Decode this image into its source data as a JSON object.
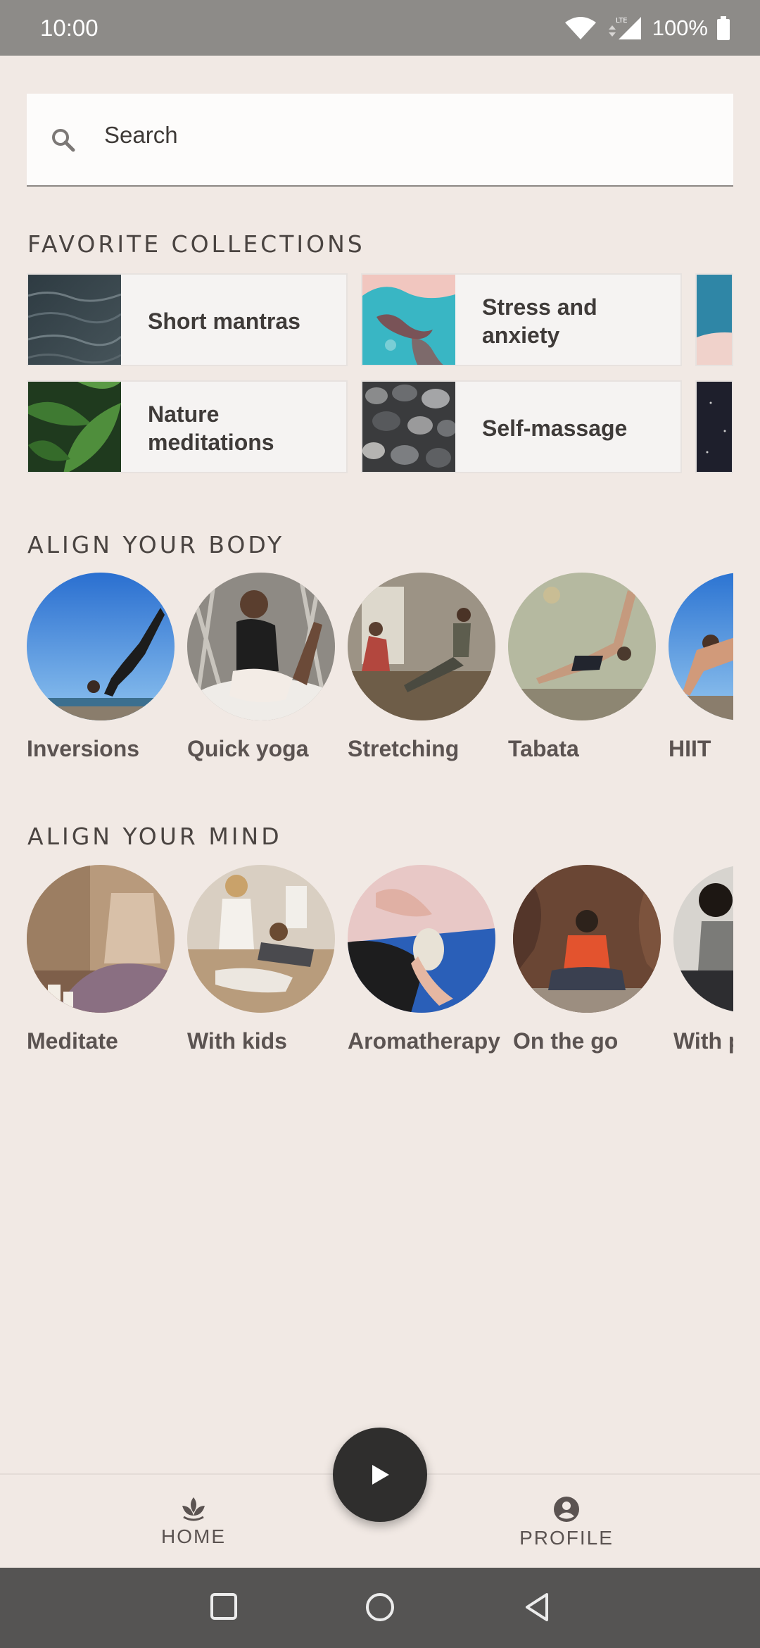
{
  "status_bar": {
    "time": "10:00",
    "network": "LTE",
    "battery": "100%"
  },
  "search": {
    "placeholder": "Search",
    "icon": "search-icon"
  },
  "sections": {
    "favorite_collections": "FAVORITE COLLECTIONS",
    "align_body": "ALIGN YOUR BODY",
    "align_mind": "ALIGN YOUR MIND"
  },
  "collections": [
    {
      "label": "Short mantras",
      "image": "ocean-waves"
    },
    {
      "label": "Stress and anxiety",
      "image": "aerial-beach"
    },
    {
      "label": "",
      "image": "sky-clouds"
    },
    {
      "label": "Nature meditations",
      "image": "green-leaves"
    },
    {
      "label": "Self-massage",
      "image": "pebbles"
    },
    {
      "label": "",
      "image": "night-sky"
    }
  ],
  "body_items": [
    {
      "label": "Inversions",
      "image": "yoga-inversion-sky"
    },
    {
      "label": "Quick yoga",
      "image": "woman-yoga-stretch"
    },
    {
      "label": "Stretching",
      "image": "group-stretching"
    },
    {
      "label": "Tabata",
      "image": "man-side-plank"
    },
    {
      "label": "HIIT",
      "image": "man-workout-sky"
    }
  ],
  "mind_items": [
    {
      "label": "Meditate",
      "image": "meditation-candles"
    },
    {
      "label": "With kids",
      "image": "mother-child-yoga"
    },
    {
      "label": "Aromatherapy",
      "image": "sage-bundle"
    },
    {
      "label": "On the go",
      "image": "man-meditating-rocks"
    },
    {
      "label": "With p",
      "image": "woman-sitting"
    }
  ],
  "bottom_nav": {
    "home": "HOME",
    "profile": "PROFILE",
    "play": "play-icon"
  },
  "colors": {
    "background": "#f1e9e4",
    "status_bar": "#8d8b88",
    "fab": "#2f2e2d",
    "system_nav": "#555453"
  }
}
